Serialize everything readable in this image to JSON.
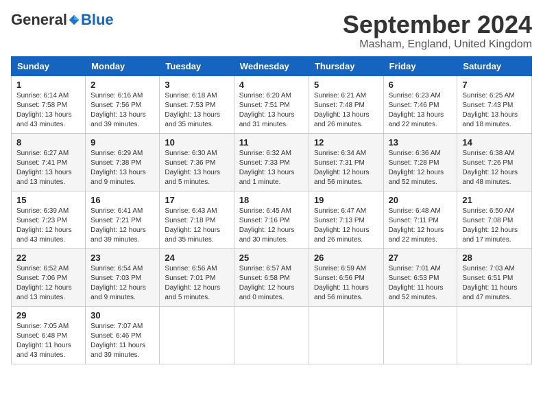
{
  "header": {
    "logo_general": "General",
    "logo_blue": "Blue",
    "month_title": "September 2024",
    "location": "Masham, England, United Kingdom"
  },
  "columns": [
    "Sunday",
    "Monday",
    "Tuesday",
    "Wednesday",
    "Thursday",
    "Friday",
    "Saturday"
  ],
  "weeks": [
    [
      {
        "day": "1",
        "sunrise": "Sunrise: 6:14 AM",
        "sunset": "Sunset: 7:58 PM",
        "daylight": "Daylight: 13 hours and 43 minutes."
      },
      {
        "day": "2",
        "sunrise": "Sunrise: 6:16 AM",
        "sunset": "Sunset: 7:56 PM",
        "daylight": "Daylight: 13 hours and 39 minutes."
      },
      {
        "day": "3",
        "sunrise": "Sunrise: 6:18 AM",
        "sunset": "Sunset: 7:53 PM",
        "daylight": "Daylight: 13 hours and 35 minutes."
      },
      {
        "day": "4",
        "sunrise": "Sunrise: 6:20 AM",
        "sunset": "Sunset: 7:51 PM",
        "daylight": "Daylight: 13 hours and 31 minutes."
      },
      {
        "day": "5",
        "sunrise": "Sunrise: 6:21 AM",
        "sunset": "Sunset: 7:48 PM",
        "daylight": "Daylight: 13 hours and 26 minutes."
      },
      {
        "day": "6",
        "sunrise": "Sunrise: 6:23 AM",
        "sunset": "Sunset: 7:46 PM",
        "daylight": "Daylight: 13 hours and 22 minutes."
      },
      {
        "day": "7",
        "sunrise": "Sunrise: 6:25 AM",
        "sunset": "Sunset: 7:43 PM",
        "daylight": "Daylight: 13 hours and 18 minutes."
      }
    ],
    [
      {
        "day": "8",
        "sunrise": "Sunrise: 6:27 AM",
        "sunset": "Sunset: 7:41 PM",
        "daylight": "Daylight: 13 hours and 13 minutes."
      },
      {
        "day": "9",
        "sunrise": "Sunrise: 6:29 AM",
        "sunset": "Sunset: 7:38 PM",
        "daylight": "Daylight: 13 hours and 9 minutes."
      },
      {
        "day": "10",
        "sunrise": "Sunrise: 6:30 AM",
        "sunset": "Sunset: 7:36 PM",
        "daylight": "Daylight: 13 hours and 5 minutes."
      },
      {
        "day": "11",
        "sunrise": "Sunrise: 6:32 AM",
        "sunset": "Sunset: 7:33 PM",
        "daylight": "Daylight: 13 hours and 1 minute."
      },
      {
        "day": "12",
        "sunrise": "Sunrise: 6:34 AM",
        "sunset": "Sunset: 7:31 PM",
        "daylight": "Daylight: 12 hours and 56 minutes."
      },
      {
        "day": "13",
        "sunrise": "Sunrise: 6:36 AM",
        "sunset": "Sunset: 7:28 PM",
        "daylight": "Daylight: 12 hours and 52 minutes."
      },
      {
        "day": "14",
        "sunrise": "Sunrise: 6:38 AM",
        "sunset": "Sunset: 7:26 PM",
        "daylight": "Daylight: 12 hours and 48 minutes."
      }
    ],
    [
      {
        "day": "15",
        "sunrise": "Sunrise: 6:39 AM",
        "sunset": "Sunset: 7:23 PM",
        "daylight": "Daylight: 12 hours and 43 minutes."
      },
      {
        "day": "16",
        "sunrise": "Sunrise: 6:41 AM",
        "sunset": "Sunset: 7:21 PM",
        "daylight": "Daylight: 12 hours and 39 minutes."
      },
      {
        "day": "17",
        "sunrise": "Sunrise: 6:43 AM",
        "sunset": "Sunset: 7:18 PM",
        "daylight": "Daylight: 12 hours and 35 minutes."
      },
      {
        "day": "18",
        "sunrise": "Sunrise: 6:45 AM",
        "sunset": "Sunset: 7:16 PM",
        "daylight": "Daylight: 12 hours and 30 minutes."
      },
      {
        "day": "19",
        "sunrise": "Sunrise: 6:47 AM",
        "sunset": "Sunset: 7:13 PM",
        "daylight": "Daylight: 12 hours and 26 minutes."
      },
      {
        "day": "20",
        "sunrise": "Sunrise: 6:48 AM",
        "sunset": "Sunset: 7:11 PM",
        "daylight": "Daylight: 12 hours and 22 minutes."
      },
      {
        "day": "21",
        "sunrise": "Sunrise: 6:50 AM",
        "sunset": "Sunset: 7:08 PM",
        "daylight": "Daylight: 12 hours and 17 minutes."
      }
    ],
    [
      {
        "day": "22",
        "sunrise": "Sunrise: 6:52 AM",
        "sunset": "Sunset: 7:06 PM",
        "daylight": "Daylight: 12 hours and 13 minutes."
      },
      {
        "day": "23",
        "sunrise": "Sunrise: 6:54 AM",
        "sunset": "Sunset: 7:03 PM",
        "daylight": "Daylight: 12 hours and 9 minutes."
      },
      {
        "day": "24",
        "sunrise": "Sunrise: 6:56 AM",
        "sunset": "Sunset: 7:01 PM",
        "daylight": "Daylight: 12 hours and 5 minutes."
      },
      {
        "day": "25",
        "sunrise": "Sunrise: 6:57 AM",
        "sunset": "Sunset: 6:58 PM",
        "daylight": "Daylight: 12 hours and 0 minutes."
      },
      {
        "day": "26",
        "sunrise": "Sunrise: 6:59 AM",
        "sunset": "Sunset: 6:56 PM",
        "daylight": "Daylight: 11 hours and 56 minutes."
      },
      {
        "day": "27",
        "sunrise": "Sunrise: 7:01 AM",
        "sunset": "Sunset: 6:53 PM",
        "daylight": "Daylight: 11 hours and 52 minutes."
      },
      {
        "day": "28",
        "sunrise": "Sunrise: 7:03 AM",
        "sunset": "Sunset: 6:51 PM",
        "daylight": "Daylight: 11 hours and 47 minutes."
      }
    ],
    [
      {
        "day": "29",
        "sunrise": "Sunrise: 7:05 AM",
        "sunset": "Sunset: 6:48 PM",
        "daylight": "Daylight: 11 hours and 43 minutes."
      },
      {
        "day": "30",
        "sunrise": "Sunrise: 7:07 AM",
        "sunset": "Sunset: 6:46 PM",
        "daylight": "Daylight: 11 hours and 39 minutes."
      },
      null,
      null,
      null,
      null,
      null
    ]
  ]
}
